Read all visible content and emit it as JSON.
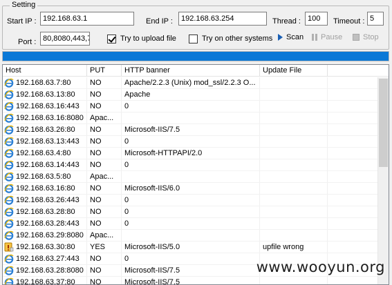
{
  "setting": {
    "group_label": "Setting",
    "start_ip_label": "Start IP :",
    "start_ip_value": "192.168.63.1",
    "end_ip_label": "End IP :",
    "end_ip_value": "192.168.63.254",
    "thread_label": "Thread :",
    "thread_value": "100",
    "timeout_label": "Timeout :",
    "timeout_value": "5",
    "port_label": "Port :",
    "port_value": "80,8080,443,7",
    "upload_label": "Try to upload file",
    "upload_checked": true,
    "other_label": "Try on other systems",
    "other_checked": false,
    "scan_label": "Scan",
    "pause_label": "Pause",
    "stop_label": "Stop"
  },
  "progress": {
    "percent": 100,
    "color": "#0a78d7"
  },
  "table": {
    "columns": [
      "Host",
      "PUT",
      "HTTP banner",
      "Update File"
    ],
    "rows": [
      {
        "host": "192.168.63.7:80",
        "put": "NO",
        "banner": "Apache/2.2.3 (Unix) mod_ssl/2.2.3 O...",
        "update": "",
        "icon": "ie-icon"
      },
      {
        "host": "192.168.63.13:80",
        "put": "NO",
        "banner": "Apache",
        "update": "",
        "icon": "ie-icon"
      },
      {
        "host": "192.168.63.16:443",
        "put": "NO",
        "banner": "0",
        "update": "",
        "icon": "ie-icon"
      },
      {
        "host": "192.168.63.16:8080",
        "put": "Apac...",
        "banner": "",
        "update": "",
        "icon": "ie-icon"
      },
      {
        "host": "192.168.63.26:80",
        "put": "NO",
        "banner": "Microsoft-IIS/7.5",
        "update": "",
        "icon": "ie-icon"
      },
      {
        "host": "192.168.63.13:443",
        "put": "NO",
        "banner": "0",
        "update": "",
        "icon": "ie-icon"
      },
      {
        "host": "192.168.63.4:80",
        "put": "NO",
        "banner": "Microsoft-HTTPAPI/2.0",
        "update": "",
        "icon": "ie-icon"
      },
      {
        "host": "192.168.63.14:443",
        "put": "NO",
        "banner": "0",
        "update": "",
        "icon": "ie-icon"
      },
      {
        "host": "192.168.63.5:80",
        "put": "Apac...",
        "banner": "",
        "update": "",
        "icon": "ie-icon"
      },
      {
        "host": "192.168.63.16:80",
        "put": "NO",
        "banner": "Microsoft-IIS/6.0",
        "update": "",
        "icon": "ie-icon"
      },
      {
        "host": "192.168.63.26:443",
        "put": "NO",
        "banner": "0",
        "update": "",
        "icon": "ie-icon"
      },
      {
        "host": "192.168.63.28:80",
        "put": "NO",
        "banner": "0",
        "update": "",
        "icon": "ie-icon"
      },
      {
        "host": "192.168.63.28:443",
        "put": "NO",
        "banner": "0",
        "update": "",
        "icon": "ie-icon"
      },
      {
        "host": "192.168.63.29:8080",
        "put": "Apac...",
        "banner": "",
        "update": "",
        "icon": "ie-icon"
      },
      {
        "host": "192.168.63.30:80",
        "put": "YES",
        "banner": "Microsoft-IIS/5.0",
        "update": "upfile wrong",
        "icon": "warning-icon"
      },
      {
        "host": "192.168.63.27:443",
        "put": "NO",
        "banner": "0",
        "update": "",
        "icon": "ie-icon"
      },
      {
        "host": "192.168.63.28:8080",
        "put": "NO",
        "banner": "Microsoft-IIS/7.5",
        "update": "",
        "icon": "ie-icon"
      },
      {
        "host": "192.168.63.37:80",
        "put": "NO",
        "banner": "Microsoft-IIS/7.5",
        "update": "",
        "icon": "ie-icon"
      }
    ]
  },
  "watermark": "www.wooyun.org"
}
